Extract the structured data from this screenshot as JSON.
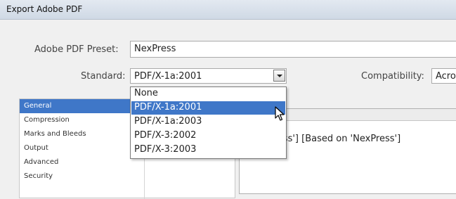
{
  "window": {
    "title": "Export Adobe PDF"
  },
  "preset": {
    "label": "Adobe PDF Preset:",
    "value": "NexPress"
  },
  "standard": {
    "label": "Standard:",
    "value": "PDF/X-1a:2001",
    "options": [
      "None",
      "PDF/X-1a:2001",
      "PDF/X-1a:2003",
      "PDF/X-3:2002",
      "PDF/X-3:2003"
    ]
  },
  "compatibility": {
    "label": "Compatibility:",
    "value": "Acrol"
  },
  "sidebar": {
    "items": [
      {
        "label": "General"
      },
      {
        "label": "Compression"
      },
      {
        "label": "Marks and Bleeds"
      },
      {
        "label": "Output"
      },
      {
        "label": "Advanced"
      },
      {
        "label": "Security"
      }
    ]
  },
  "description": {
    "text": "n 'NexPress'] [Based on 'NexPress']"
  },
  "colors": {
    "selection": "#3f77c8"
  }
}
